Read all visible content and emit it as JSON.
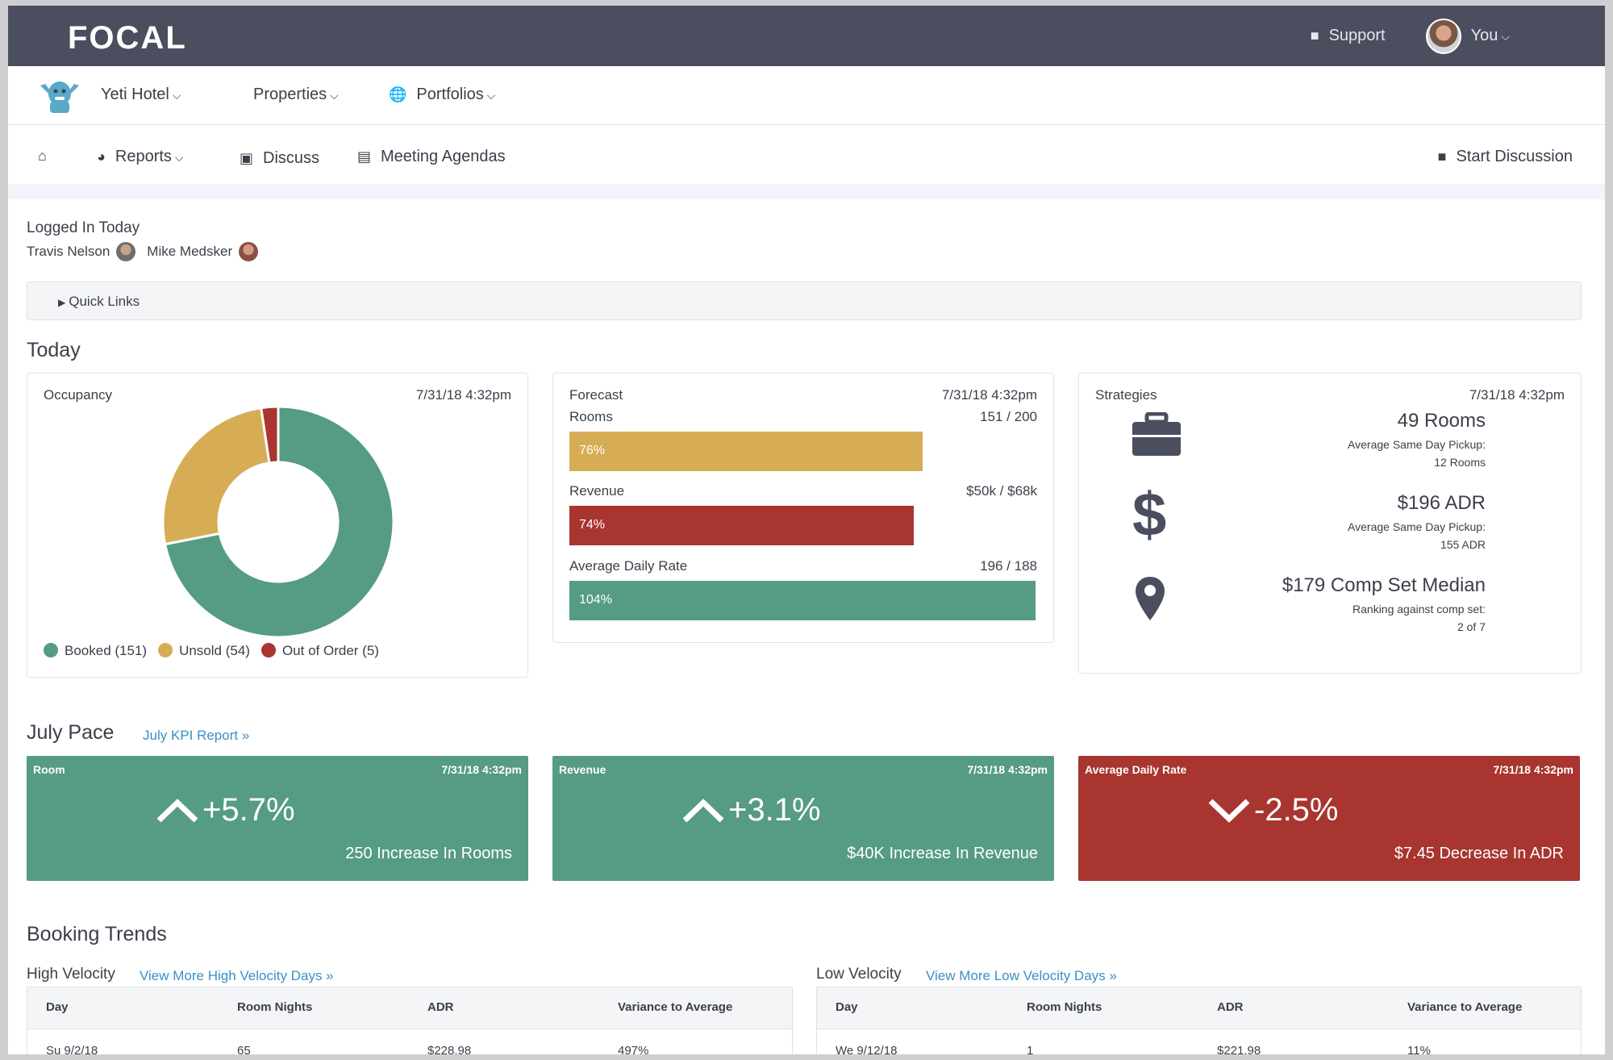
{
  "header": {
    "logo": "FOCAL",
    "support_label": "Support",
    "user_label": "You"
  },
  "propbar": {
    "hotel": "Yeti Hotel",
    "properties": "Properties",
    "portfolios": "Portfolios"
  },
  "subnav": {
    "reports": "Reports",
    "discuss": "Discuss",
    "agendas": "Meeting Agendas",
    "start_discussion": "Start Discussion"
  },
  "logged_in": {
    "title": "Logged In Today",
    "users": [
      "Travis Nelson",
      "Mike Medsker"
    ]
  },
  "quick_links": "Quick Links",
  "today": {
    "heading": "Today",
    "occupancy": {
      "title": "Occupancy",
      "timestamp": "7/31/18 4:32pm",
      "legend": [
        "Booked (151)",
        "Unsold (54)",
        "Out of Order (5)"
      ]
    },
    "forecast": {
      "title": "Forecast",
      "timestamp": "7/31/18 4:32pm",
      "rows": [
        {
          "label": "Rooms",
          "value": "151 / 200",
          "pct_label": "76%",
          "pct": 0.76
        },
        {
          "label": "Revenue",
          "value": "$50k / $68k",
          "pct_label": "74%",
          "pct": 0.74
        },
        {
          "label": "Average Daily Rate",
          "value": "196 / 188",
          "pct_label": "104%",
          "pct": 1.0
        }
      ]
    },
    "strategies": {
      "title": "Strategies",
      "timestamp": "7/31/18 4:32pm",
      "items": [
        {
          "main": "49 Rooms",
          "sub1": "Average Same Day Pickup:",
          "sub2": "12 Rooms",
          "icon": "briefcase-icon"
        },
        {
          "main": "$196 ADR",
          "sub1": "Average Same Day Pickup:",
          "sub2": "155 ADR",
          "icon": "dollar-icon"
        },
        {
          "main": "$179 Comp Set Median",
          "sub1": "Ranking against comp set:",
          "sub2": "2 of 7",
          "icon": "map-pin-icon"
        }
      ]
    }
  },
  "pace": {
    "heading": "July Pace",
    "link": "July KPI Report »",
    "cards": [
      {
        "title": "Room",
        "timestamp": "7/31/18 4:32pm",
        "value": "+5.7%",
        "sub": "250 Increase In Rooms",
        "dir": "up"
      },
      {
        "title": "Revenue",
        "timestamp": "7/31/18 4:32pm",
        "value": "+3.1%",
        "sub": "$40K Increase In Revenue",
        "dir": "up"
      },
      {
        "title": "Average Daily Rate",
        "timestamp": "7/31/18 4:32pm",
        "value": "-2.5%",
        "sub": "$7.45 Decrease In ADR",
        "dir": "down"
      }
    ]
  },
  "trends": {
    "heading": "Booking Trends",
    "high": {
      "label": "High Velocity",
      "link": "View More High Velocity Days »",
      "columns": [
        "Day",
        "Room Nights",
        "ADR",
        "Variance to Average"
      ],
      "row": [
        "Su 9/2/18",
        "65",
        "$228.98",
        "497%"
      ]
    },
    "low": {
      "label": "Low Velocity",
      "link": "View More Low Velocity Days »",
      "columns": [
        "Day",
        "Room Nights",
        "ADR",
        "Variance to Average"
      ],
      "row": [
        "We 9/12/18",
        "1",
        "$221.98",
        "11%"
      ]
    }
  },
  "chart_data": {
    "type": "pie",
    "categories": [
      "Booked",
      "Unsold",
      "Out of Order"
    ],
    "values": [
      151,
      54,
      5
    ],
    "colors": [
      "#559c82",
      "#d6ad55",
      "#a8352f"
    ]
  },
  "colors": {
    "green": "#559c82",
    "yellow": "#d6ad55",
    "red": "#a8352f",
    "header": "#4a4e5f",
    "link": "#3a8fc4"
  }
}
